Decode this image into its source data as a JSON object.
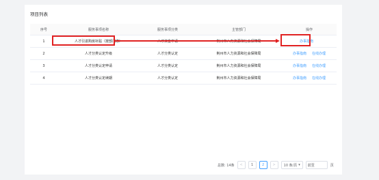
{
  "panel": {
    "title": "项目列表"
  },
  "table": {
    "headers": {
      "no": "序号",
      "name": "服务事项名称",
      "category": "服务事项分类",
      "dept": "主管部门",
      "ops": "操作"
    },
    "rows": [
      {
        "no": "1",
        "name": "人才引进购房补贴（按部门修）",
        "category": "人才资金申请",
        "dept": "荆州市人力资源和社会保障局",
        "guide": "办事指南",
        "online": ""
      },
      {
        "no": "2",
        "name": "人才分类认定升级",
        "category": "人才分类认定",
        "dept": "荆州市人力资源和社会保障局",
        "guide": "办事指南",
        "online": "在线办理"
      },
      {
        "no": "3",
        "name": "人才分类认定申请",
        "category": "人才分类认定",
        "dept": "荆州市人力资源和社会保障局",
        "guide": "办事指南",
        "online": "在线办理"
      },
      {
        "no": "4",
        "name": "人才分类认定续期",
        "category": "人才分类认定",
        "dept": "荆州市人力资源和社会保障局",
        "guide": "办事指南",
        "online": "在线办理"
      }
    ]
  },
  "pagination": {
    "total": "总数: 14条",
    "prev": "<",
    "page1": "1",
    "page2": "2",
    "next": ">",
    "page_size": "10 条/页",
    "page_size_arrow": "▾",
    "jump_placeholder": "前至",
    "page_suffix": "页"
  },
  "colors": {
    "accent": "#409eff",
    "annotation": "#e02020"
  }
}
